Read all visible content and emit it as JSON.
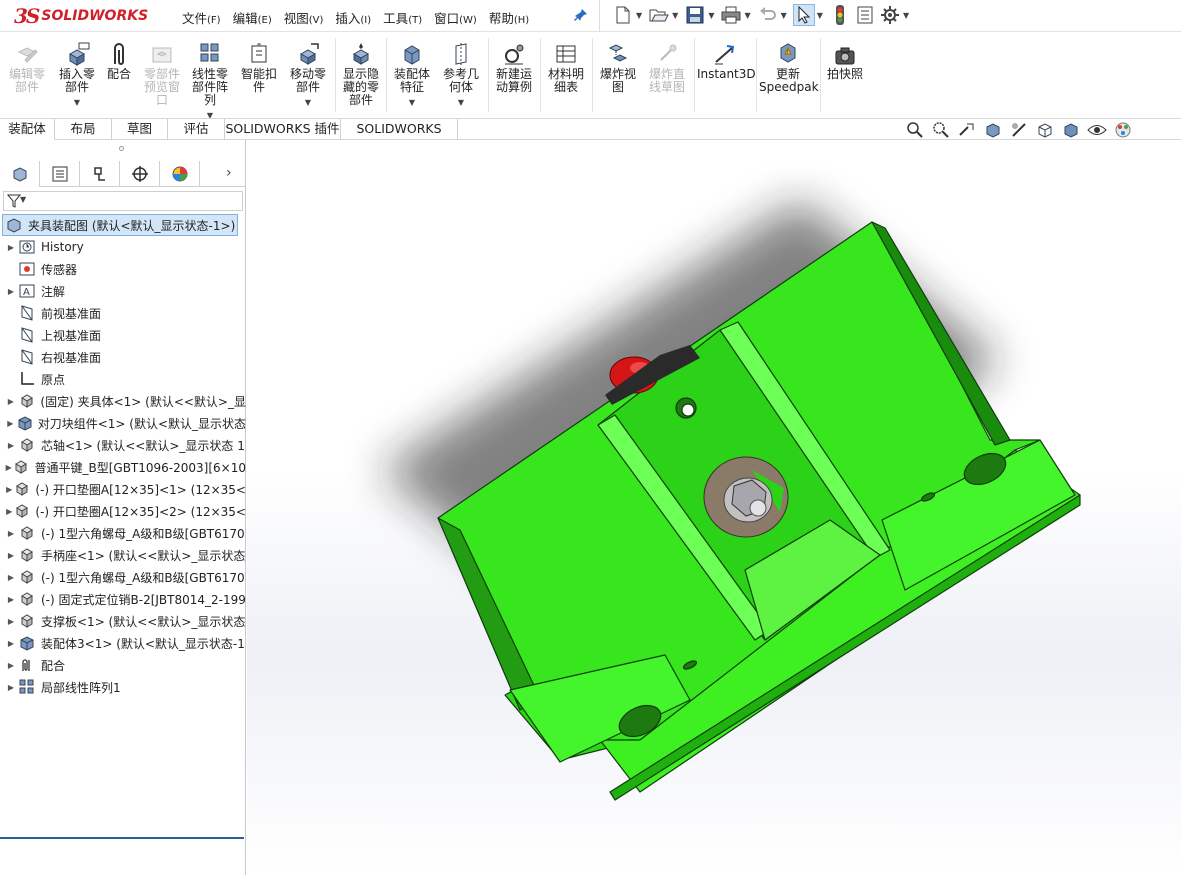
{
  "app": {
    "logo_mark": "3S",
    "logo_text": "SOLIDWORKS"
  },
  "menus": [
    {
      "label": "文件",
      "key": "(F)"
    },
    {
      "label": "编辑",
      "key": "(E)"
    },
    {
      "label": "视图",
      "key": "(V)"
    },
    {
      "label": "插入",
      "key": "(I)"
    },
    {
      "label": "工具",
      "key": "(T)"
    },
    {
      "label": "窗口",
      "key": "(W)"
    },
    {
      "label": "帮助",
      "key": "(H)"
    }
  ],
  "commands": [
    {
      "line1": "编辑零",
      "line2": "部件",
      "line3": "",
      "icon": "edit-component-icon",
      "disabled": true
    },
    {
      "line1": "插入零",
      "line2": "部件",
      "line3": "",
      "icon": "insert-component-icon",
      "disabled": false
    },
    {
      "line1": "配合",
      "line2": "",
      "line3": "",
      "icon": "mate-icon",
      "disabled": false
    },
    {
      "line1": "零部件",
      "line2": "预览窗",
      "line3": "口",
      "icon": "component-preview-icon",
      "disabled": true
    },
    {
      "line1": "线性零",
      "line2": "部件阵",
      "line3": "列",
      "icon": "linear-pattern-icon",
      "disabled": false
    },
    {
      "line1": "智能扣",
      "line2": "件",
      "line3": "",
      "icon": "smart-fasteners-icon",
      "disabled": false
    },
    {
      "line1": "移动零",
      "line2": "部件",
      "line3": "",
      "icon": "move-component-icon",
      "disabled": false
    },
    {
      "line1": "显示隐",
      "line2": "藏的零",
      "line3": "部件",
      "icon": "show-hidden-icon",
      "disabled": false
    },
    {
      "line1": "装配体",
      "line2": "特征",
      "line3": "",
      "icon": "assembly-features-icon",
      "disabled": false
    },
    {
      "line1": "参考几",
      "line2": "何体",
      "line3": "",
      "icon": "reference-geometry-icon",
      "disabled": false
    },
    {
      "line1": "新建运",
      "line2": "动算例",
      "line3": "",
      "icon": "motion-study-icon",
      "disabled": false
    },
    {
      "line1": "材料明",
      "line2": "细表",
      "line3": "",
      "icon": "bom-icon",
      "disabled": false
    },
    {
      "line1": "爆炸视",
      "line2": "图",
      "line3": "",
      "icon": "exploded-view-icon",
      "disabled": false
    },
    {
      "line1": "爆炸直",
      "line2": "线草图",
      "line3": "",
      "icon": "explode-line-sketch-icon",
      "disabled": true
    },
    {
      "line1": "Instant3D",
      "line2": "",
      "line3": "",
      "icon": "instant3d-icon",
      "disabled": false
    },
    {
      "line1": "更新",
      "line2": "Speedpak",
      "line3": "",
      "icon": "speedpak-icon",
      "disabled": false
    },
    {
      "line1": "拍快照",
      "line2": "",
      "line3": "",
      "icon": "snapshot-icon",
      "disabled": false
    }
  ],
  "tabs": [
    "装配体",
    "布局",
    "草图",
    "评估",
    "SOLIDWORKS 插件",
    "SOLIDWORKS MBD"
  ],
  "tree": {
    "root": "夹具装配图  (默认<默认_显示状态-1>)",
    "items": [
      {
        "label": "History",
        "icon": "history-icon",
        "expand": true
      },
      {
        "label": "传感器",
        "icon": "sensor-icon",
        "expand": false
      },
      {
        "label": "注解",
        "icon": "annotation-icon",
        "expand": true
      },
      {
        "label": "前视基准面",
        "icon": "plane-icon",
        "expand": false
      },
      {
        "label": "上视基准面",
        "icon": "plane-icon",
        "expand": false
      },
      {
        "label": "右视基准面",
        "icon": "plane-icon",
        "expand": false
      },
      {
        "label": "原点",
        "icon": "origin-icon",
        "expand": false
      },
      {
        "label": "(固定) 夹具体<1> (默认<<默认>_显",
        "icon": "part-icon",
        "expand": true
      },
      {
        "label": "对刀块组件<1> (默认<默认_显示状态",
        "icon": "subassembly-icon",
        "expand": true
      },
      {
        "label": "芯轴<1> (默认<<默认>_显示状态 1",
        "icon": "part-icon",
        "expand": true
      },
      {
        "label": "普通平键_B型[GBT1096-2003][6×10",
        "icon": "part-icon",
        "expand": true
      },
      {
        "label": "(-) 开口垫圈A[12×35]<1> (12×35<",
        "icon": "part-icon",
        "expand": true
      },
      {
        "label": "(-) 开口垫圈A[12×35]<2> (12×35<",
        "icon": "part-icon",
        "expand": true
      },
      {
        "label": "(-) 1型六角螺母_A级和B级[GBT6170",
        "icon": "part-icon",
        "expand": true
      },
      {
        "label": "手柄座<1> (默认<<默认>_显示状态",
        "icon": "part-icon",
        "expand": true
      },
      {
        "label": "(-) 1型六角螺母_A级和B级[GBT6170",
        "icon": "part-icon",
        "expand": true
      },
      {
        "label": "(-) 固定式定位销B-2[JBT8014_2-199",
        "icon": "part-icon",
        "expand": true
      },
      {
        "label": "支撑板<1> (默认<<默认>_显示状态",
        "icon": "part-icon",
        "expand": true
      },
      {
        "label": "装配体3<1> (默认<默认_显示状态-1",
        "icon": "subassembly-icon",
        "expand": true
      },
      {
        "label": "配合",
        "icon": "mates-folder-icon",
        "expand": true
      },
      {
        "label": "局部线性阵列1",
        "icon": "local-pattern-icon",
        "expand": true
      }
    ]
  },
  "colors": {
    "model_green": "#2fe61a",
    "model_edge": "#0f3d0a",
    "accent_red": "#d0202a",
    "selection": "#d3e6f8"
  }
}
